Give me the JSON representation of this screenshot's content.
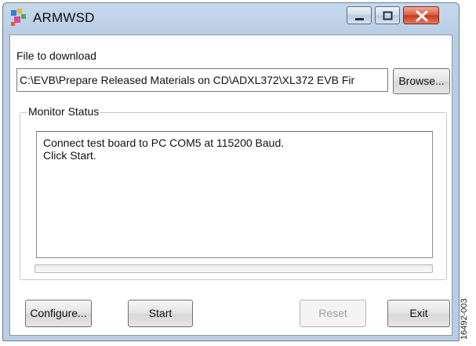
{
  "window": {
    "title": "ARMWSD",
    "icon": "armwsd-app-icon",
    "controls": {
      "minimize": "minimize-icon",
      "maximize": "maximize-icon",
      "close": "close-icon"
    }
  },
  "file_section": {
    "label": "File to download",
    "path_value": "C:\\EVB\\Prepare Released Materials on CD\\ADXL372\\XL372 EVB Fir",
    "browse_label": "Browse..."
  },
  "monitor": {
    "group_label": "Monitor Status",
    "lines": [
      "Connect test board to PC COM5 at 115200 Baud.",
      "Click Start."
    ],
    "progress": 0
  },
  "buttons": {
    "configure": "Configure...",
    "start": "Start",
    "reset": "Reset",
    "exit": "Exit"
  },
  "figure_id": "16492-003",
  "colors": {
    "title_bar": "#b9cde5",
    "close_button": "#c63a1f",
    "disabled_text": "#a0a0a0"
  }
}
